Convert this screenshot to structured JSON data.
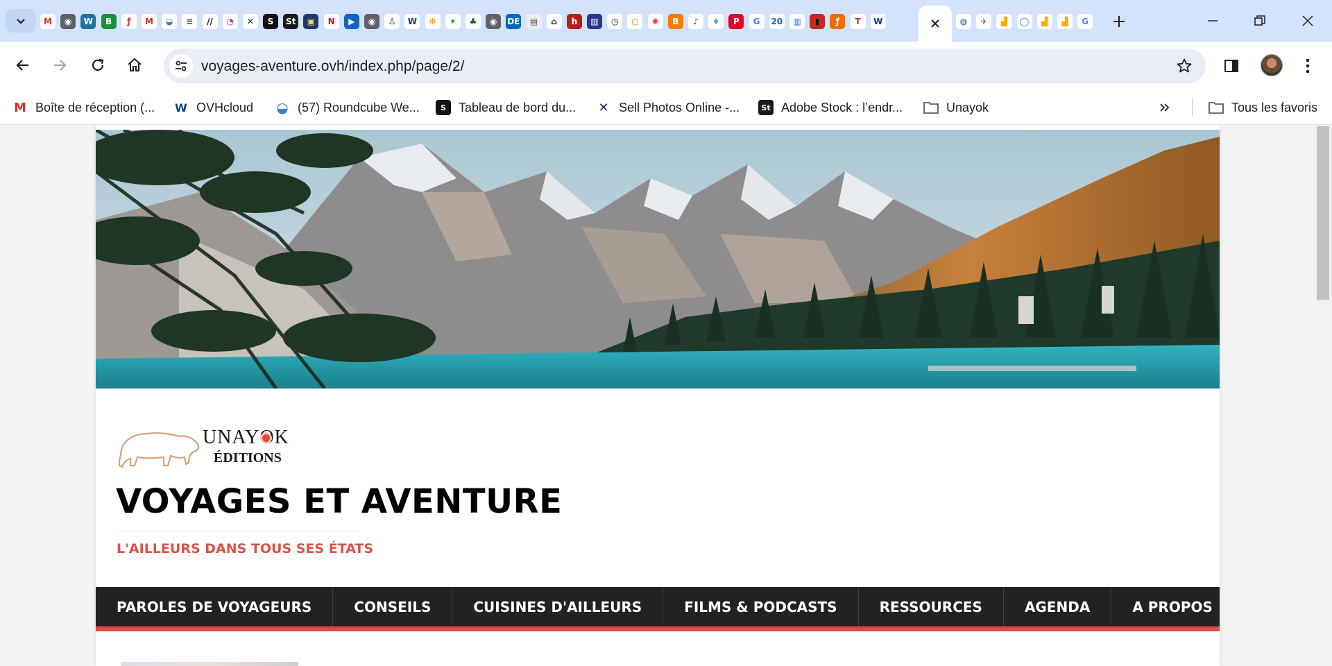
{
  "browser": {
    "tab_favicons": [
      {
        "icon": "gmail-icon",
        "glyph": "M",
        "color": "#ffffff",
        "text": "#d93025"
      },
      {
        "icon": "globe-icon",
        "glyph": "◉",
        "color": "#5f6368",
        "text": "#ffffff"
      },
      {
        "icon": "wordpress-icon",
        "glyph": "W",
        "color": "#21759b",
        "text": "#ffffff"
      },
      {
        "icon": "letter-b-icon",
        "glyph": "B",
        "color": "#1e8e3e",
        "text": "#ffffff"
      },
      {
        "icon": "script-f-icon",
        "glyph": "ƒ",
        "color": "#ffffff",
        "text": "#d32f2f"
      },
      {
        "icon": "gmail-icon",
        "glyph": "M",
        "color": "#ffffff",
        "text": "#d93025"
      },
      {
        "icon": "roundcube-icon",
        "glyph": "◒",
        "color": "#ffffff",
        "text": "#3a7ec4"
      },
      {
        "icon": "lines-icon",
        "glyph": "≡",
        "color": "#ffffff",
        "text": "#37474f"
      },
      {
        "icon": "slash-icon",
        "glyph": "//",
        "color": "#ffffff",
        "text": "#1a1a1a"
      },
      {
        "icon": "bird-icon",
        "glyph": "◔",
        "color": "#ffffff",
        "text": "#8a2be2"
      },
      {
        "icon": "wix-icon",
        "glyph": "✕",
        "color": "#ffffff",
        "text": "#0d2a5a"
      },
      {
        "icon": "squarespace-icon",
        "glyph": "S",
        "color": "#111111",
        "text": "#ffffff"
      },
      {
        "icon": "stock-st-icon",
        "glyph": "St",
        "color": "#1a1a1a",
        "text": "#ffffff"
      },
      {
        "icon": "badge-icon",
        "glyph": "▣",
        "color": "#1b3a6b",
        "text": "#ffd54f"
      },
      {
        "icon": "netflix-icon",
        "glyph": "N",
        "color": "#ffffff",
        "text": "#e50914"
      },
      {
        "icon": "play-icon",
        "glyph": "▶",
        "color": "#1565c0",
        "text": "#ffffff"
      },
      {
        "icon": "globe-icon",
        "glyph": "◉",
        "color": "#5f6368",
        "text": "#ffffff"
      },
      {
        "icon": "person-icon",
        "glyph": "♙",
        "color": "#ffffff",
        "text": "#222222"
      },
      {
        "icon": "ovh-icon",
        "glyph": "W",
        "color": "#ffffff",
        "text": "#123f8a"
      },
      {
        "icon": "joomla-icon",
        "glyph": "✻",
        "color": "#ffffff",
        "text": "#f4a300"
      },
      {
        "icon": "spark-icon",
        "glyph": "✶",
        "color": "#ffffff",
        "text": "#2e7d32"
      },
      {
        "icon": "tree-icon",
        "glyph": "♣",
        "color": "#ffffff",
        "text": "#1b5e20"
      },
      {
        "icon": "globe-icon",
        "glyph": "◉",
        "color": "#5f6368",
        "text": "#ffffff"
      },
      {
        "icon": "de-icon",
        "glyph": "DE",
        "color": "#0067b8",
        "text": "#ffffff"
      },
      {
        "icon": "calendar-icon",
        "glyph": "▤",
        "color": "#eeeeee",
        "text": "#555555"
      },
      {
        "icon": "museum-icon",
        "glyph": "⌂",
        "color": "#ffffff",
        "text": "#222222"
      },
      {
        "icon": "letter-h-icon",
        "glyph": "h",
        "color": "#b71c1c",
        "text": "#ffffff"
      },
      {
        "icon": "book-icon",
        "glyph": "▥",
        "color": "#283593",
        "text": "#ffffff"
      },
      {
        "icon": "clock-icon",
        "glyph": "◷",
        "color": "#ffffff",
        "text": "#222222"
      },
      {
        "icon": "ring-icon",
        "glyph": "○",
        "color": "#ffffff",
        "text": "#f57c00"
      },
      {
        "icon": "puzzle-icon",
        "glyph": "✺",
        "color": "#ffffff",
        "text": "#e53935"
      },
      {
        "icon": "blogger-icon",
        "glyph": "B",
        "color": "#f57c00",
        "text": "#ffffff"
      },
      {
        "icon": "mic-icon",
        "glyph": "♪",
        "color": "#ffffff",
        "text": "#555555"
      },
      {
        "icon": "drop-icon",
        "glyph": "♦",
        "color": "#ffffff",
        "text": "#42a5f5"
      },
      {
        "icon": "pinterest-icon",
        "glyph": "P",
        "color": "#e60023",
        "text": "#ffffff"
      },
      {
        "icon": "google-icon",
        "glyph": "G",
        "color": "#ffffff",
        "text": "#4285f4"
      },
      {
        "icon": "twenty-icon",
        "glyph": "20",
        "color": "#ffffff",
        "text": "#1565c0"
      },
      {
        "icon": "bars-icon",
        "glyph": "▥",
        "color": "#ffffff",
        "text": "#1a73e8"
      },
      {
        "icon": "red-square-icon",
        "glyph": "▮",
        "color": "#c62828",
        "text": "#1a1a1a"
      },
      {
        "icon": "flash-icon",
        "glyph": "ƒ",
        "color": "#ef6c00",
        "text": "#ffffff"
      },
      {
        "icon": "t-icon",
        "glyph": "T",
        "color": "#ffffff",
        "text": "#d32f2f"
      },
      {
        "icon": "ovh-icon",
        "glyph": "W",
        "color": "#ffffff",
        "text": "#123f8a"
      }
    ],
    "tab_favicons_right": [
      {
        "icon": "planet-icon",
        "glyph": "◍",
        "color": "#ffffff",
        "text": "#1e4e8c"
      },
      {
        "icon": "satellite-icon",
        "glyph": "✈",
        "color": "#ffffff",
        "text": "#5f6368"
      },
      {
        "icon": "analytics-icon",
        "glyph": "▟",
        "color": "#ffffff",
        "text": "#f9ab00"
      },
      {
        "icon": "circle-o-icon",
        "glyph": "◯",
        "color": "#ffffff",
        "text": "#1a73e8"
      },
      {
        "icon": "analytics-icon",
        "glyph": "▟",
        "color": "#ffffff",
        "text": "#f9ab00"
      },
      {
        "icon": "analytics-icon",
        "glyph": "▟",
        "color": "#ffffff",
        "text": "#f9ab00"
      },
      {
        "icon": "google-icon",
        "glyph": "G",
        "color": "#ffffff",
        "text": "#4285f4"
      }
    ],
    "url": "voyages-aventure.ovh/index.php/page/2/",
    "bookmarks": [
      {
        "label": "Boîte de réception (...",
        "icon": "gmail-icon",
        "glyph": "M",
        "bg": "#ffffff",
        "fg": "#d93025"
      },
      {
        "label": "OVHcloud",
        "icon": "ovh-icon",
        "glyph": "W",
        "bg": "#ffffff",
        "fg": "#123f8a"
      },
      {
        "label": "(57) Roundcube We...",
        "icon": "roundcube-icon",
        "glyph": "◒",
        "bg": "#ffffff",
        "fg": "#3a7ec4"
      },
      {
        "label": "Tableau de bord du...",
        "icon": "squarespace-icon",
        "glyph": "S",
        "bg": "#111111",
        "fg": "#ffffff"
      },
      {
        "label": "Sell Photos Online -...",
        "icon": "wix-icon",
        "glyph": "✕",
        "bg": "#ffffff",
        "fg": "#0d2a5a"
      },
      {
        "label": "Adobe Stock : l’endr...",
        "icon": "stock-st-icon",
        "glyph": "St",
        "bg": "#1a1a1a",
        "fg": "#ffffff"
      },
      {
        "label": "Unayok",
        "icon": "folder-icon",
        "glyph": "",
        "bg": "#ffffff",
        "fg": "#444444"
      }
    ],
    "all_bookmarks_label": "Tous les favoris"
  },
  "site": {
    "logo_line1": "UNAYOK",
    "logo_line2": "ÉDITIONS",
    "title": "VOYAGES ET AVENTURE",
    "tagline": "L'AILLEURS DANS TOUS SES ÉTATS",
    "nav": [
      "PAROLES DE VOYAGEURS",
      "CONSEILS",
      "CUISINES D'AILLEURS",
      "FILMS & PODCASTS",
      "RESSOURCES",
      "AGENDA",
      "A PROPOS"
    ],
    "colors": {
      "accent": "#e24b43",
      "nav_bg": "#222222",
      "tagline": "#d9534a"
    }
  }
}
